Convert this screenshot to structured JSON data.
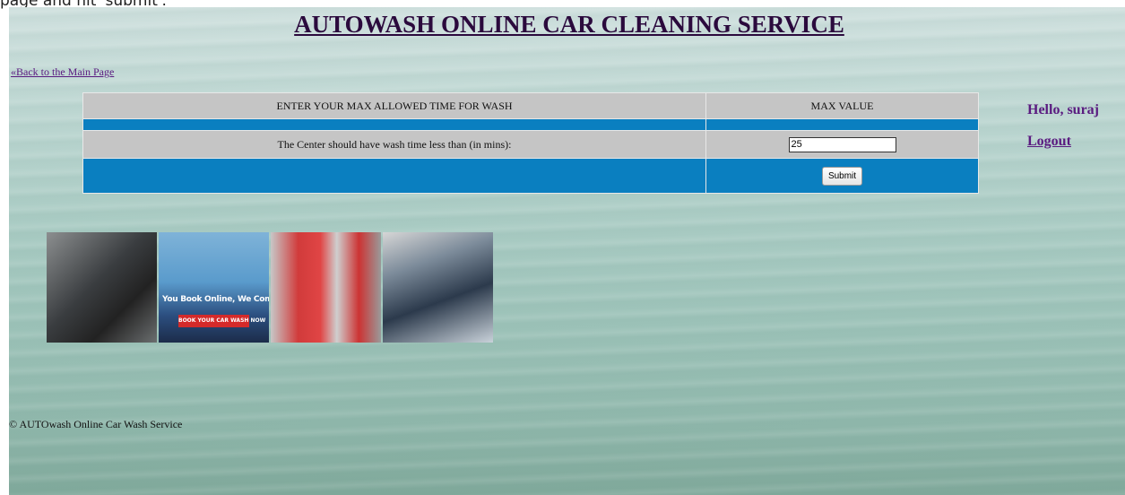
{
  "caption": "page and hit 'submit'.",
  "header": {
    "title": "AUTOWASH ONLINE CAR CLEANING SERVICE",
    "back_link": "«Back to the Main Page"
  },
  "user": {
    "greeting": "Hello, suraj",
    "logout": "Logout"
  },
  "form_table": {
    "col1_header": "ENTER YOUR MAX ALLOWED TIME FOR WASH",
    "col2_header": "MAX VALUE",
    "field_label": "The Center should have wash time less than (in mins):",
    "field_value": "25",
    "submit_label": "Submit"
  },
  "banner_images": {
    "panel2_text": "You Book Online, We Come to You",
    "panel2_button": "BOOK YOUR CAR WASH NOW"
  },
  "footer": {
    "text": "© AUTOwash Online Car Wash Service"
  }
}
